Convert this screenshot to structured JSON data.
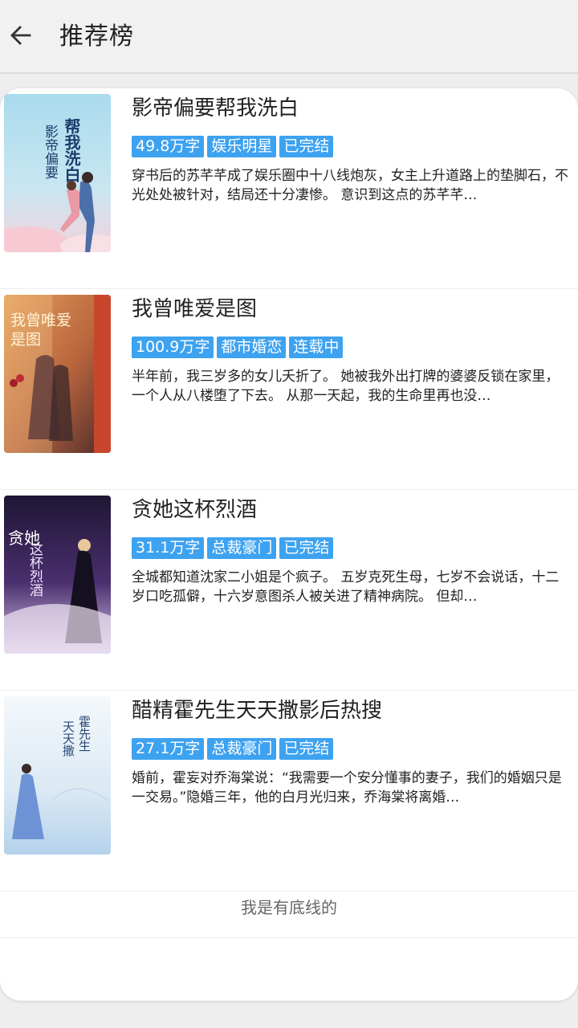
{
  "header": {
    "title": "推荐榜",
    "back_icon": "arrow-left-icon"
  },
  "books": [
    {
      "title": "影帝偏要帮我洗白",
      "words": "49.8万字",
      "genre": "娱乐明星",
      "status": "已完结",
      "desc": "穿书后的苏芊芊成了娱乐圈中十八线炮灰，女主上升道路上的垫脚石，不光处处被针对，结局还十分凄惨。 意识到这点的苏芊芊…",
      "cover_text": [
        "帮我洗白",
        "影帝偏要"
      ],
      "cover_colors": [
        "#8fd0ea",
        "#f4c6cf"
      ]
    },
    {
      "title": "我曾唯爱是图",
      "words": "100.9万字",
      "genre": "都市婚恋",
      "status": "连载中",
      "desc": "半年前，我三岁多的女儿夭折了。 她被我外出打牌的婆婆反锁在家里，一个人从八楼堕了下去。 从那一天起，我的生命里再也没…",
      "cover_text": [
        "我曾唯爱",
        "是图"
      ],
      "cover_colors": [
        "#d9863c",
        "#6b3a3a"
      ]
    },
    {
      "title": "贪她这杯烈酒",
      "words": "31.1万字",
      "genre": "总裁豪门",
      "status": "已完结",
      "desc": "全城都知道沈家二小姐是个疯子。 五岁克死生母，七岁不会说话，十二岁口吃孤僻，十六岁意图杀人被关进了精神病院。 但却…",
      "cover_text": [
        "贪她",
        "这杯烈酒"
      ],
      "cover_colors": [
        "#2a1d4a",
        "#b487c6"
      ]
    },
    {
      "title": "醋精霍先生天天撒影后热搜",
      "words": "27.1万字",
      "genre": "总裁豪门",
      "status": "已完结",
      "desc": "婚前，霍妄对乔海棠说：“我需要一个安分懂事的妻子，我们的婚姻只是一交易。”隐婚三年，他的白月光归来，乔海棠将离婚…",
      "cover_text": [
        "霍先生",
        "天天撒"
      ],
      "cover_colors": [
        "#e6f0f7",
        "#9cc3e6"
      ]
    }
  ],
  "footer": {
    "text": "我是有底线的"
  }
}
